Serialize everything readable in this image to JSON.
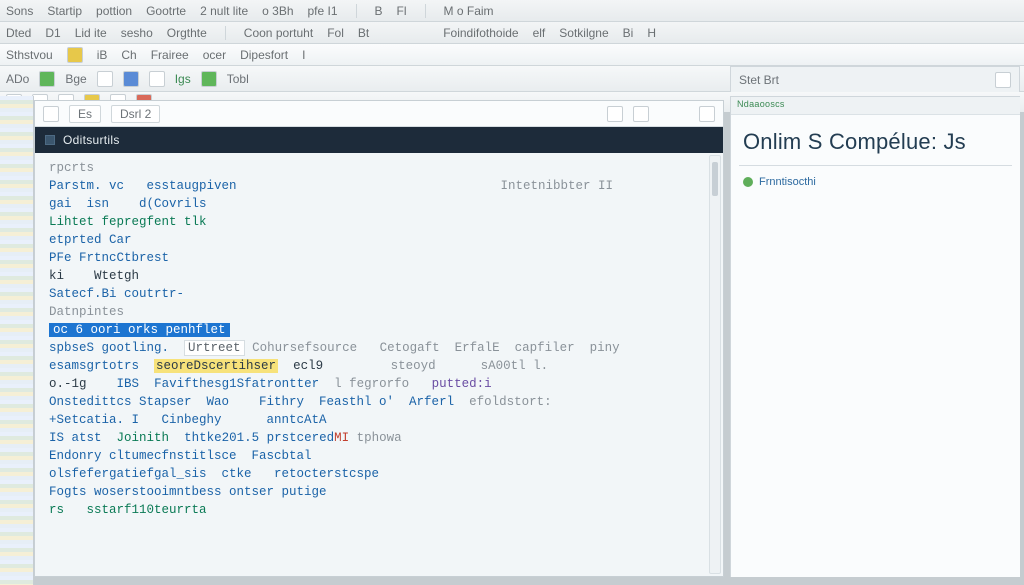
{
  "menubar1": [
    "Sons",
    "Startip",
    "pottion",
    "Gootrte",
    "2 nult lite",
    "o 3Bh",
    "pfe I1",
    "B",
    "Fl",
    "M o Faim"
  ],
  "menubar2": [
    "Dted",
    "D1",
    "Lid ite",
    "sesho",
    "Orgthte",
    "Coon portuht",
    "Fol",
    "Bt",
    "Foindifothoide",
    "elf",
    "Sotkilgne",
    "Bi",
    "H"
  ],
  "menubar3": [
    "Sthstvou",
    "iB",
    "Ch",
    "Frairee",
    "ocer",
    "Dipesfort",
    "I"
  ],
  "toolbar1": [
    "ADo",
    "Bge",
    "Igs",
    "Tobl"
  ],
  "tabstrip": {
    "label": "Stet Brt"
  },
  "editor": {
    "tabs": [
      "Es",
      "Dsrl 2"
    ],
    "title": "Oditsurtils",
    "right_hint": "Intetnibbter II",
    "lines": [
      {
        "t": "rpcrts",
        "cls": "dim"
      },
      {
        "t": "Parstm. vc   esstaugpiven",
        "cls": "kw"
      },
      {
        "t": "gai  isn    d(Covrils",
        "cls": "kw"
      },
      {
        "t": "Lihtet fepregfent tlk",
        "cls": "kw2"
      },
      {
        "t": "etprted Car",
        "cls": "kw"
      },
      {
        "t": "PFe FrtncCtbrest",
        "cls": "kw"
      },
      {
        "t": "ki    Wtetgh",
        "cls": ""
      },
      {
        "t": "Satecf.Bi coutrtr-",
        "cls": "kw"
      },
      {
        "t": "Datnpintes",
        "cls": "dim"
      }
    ],
    "sel_line": "oc 6 oori orks penhflet",
    "line11_a": "spbseS gootling.",
    "line11_b": "Urtreet",
    "line11_c": "Cohursefsource   Cetogaft  ErfalE  capfiler  piny",
    "line12_a": "esamsgrtotrs",
    "line12_b": "seoreDscertihser",
    "line12_c": "ecl9",
    "line12_d": "steoyd",
    "line12_e": "sA00tl l.",
    "line13_a": "o.-1g",
    "line13_b": "IBS",
    "line13_c": "Favifthesg1Sfatrontter",
    "line13_d": "l fegrorfo",
    "line13_e": "putted:i",
    "line14_a": "Onstedittcs Stapser  Wao    Fithry  Feasthl o'  Arferl",
    "line14_b": "efoldstort:",
    "line15": "+Setcatia. I   Cinbeghy      anntcAtA",
    "line16_a": "IS atst",
    "line16_b": "Joinith",
    "line16_c": "thtke201.5 prstcered",
    "line16_d": "MI",
    "line16_e": "tphowa",
    "line17": "Endonry cltumecfnstitlsce  Fascbtal",
    "line18": "olsfefergatiefgal_sis  ctke   retocterstcspe",
    "line19": "Fogts woserstooimntbess ontser putige",
    "line20": "rs   sstarf110teurrta"
  },
  "side": {
    "head": "Ndaaooscs",
    "title": "Onlim S Compélue: Js",
    "item": "Frnntisocthi"
  }
}
